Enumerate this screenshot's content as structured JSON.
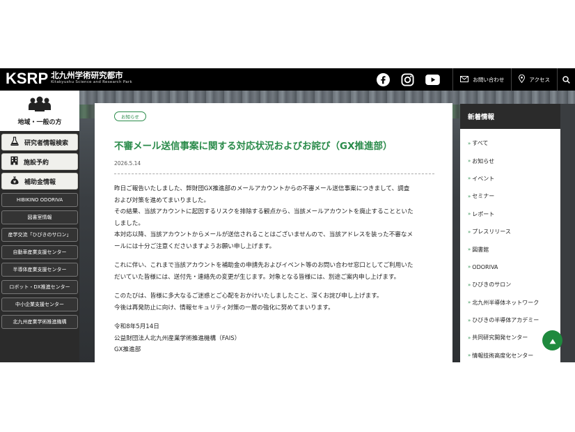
{
  "header": {
    "logo_mark": "KSRP",
    "logo_jp": "北九州学術研究都市",
    "logo_en": "Kitakyushu Science and Research Park",
    "contact_label": "お問い合わせ",
    "access_label": "アクセス"
  },
  "leftnav": {
    "region_label": "地域・一般の方",
    "big_buttons": [
      {
        "label": "研究者情報検索",
        "icon": "flask-icon"
      },
      {
        "label": "施設予約",
        "icon": "building-icon"
      },
      {
        "label": "補助金情報",
        "icon": "money-bag-icon"
      }
    ],
    "small_buttons": [
      "HIBIKINO ODORIVA",
      "図書室情報",
      "産学交流「ひびきのサロン」",
      "自動車産業支援センター",
      "半導体産業支援センター",
      "ロボット・DX推進センター",
      "中小企業支援センター",
      "北九州産業学術推進機構"
    ]
  },
  "article": {
    "tag": "お知らせ",
    "title": "不審メール送信事案に関する対応状況およびお詫び（GX推進部）",
    "date": "2026.5.14",
    "p1": [
      "昨日ご報告いたしました、弊財団GX推進部のメールアカウントからの不審メール送信事案につきまして、調査",
      "および対策を進めてまいりました。",
      "その結果、当該アカウントに起因するリスクを排除する観点から、当該メールアカウントを廃止することといた",
      "しました。",
      "本対応以降、当該アカウントからメールが送信されることはございませんので、当該アドレスを装った不審なメ",
      "ールには十分ご注意くださいますようお願い申し上げます。"
    ],
    "p2": [
      "これに伴い、これまで当該アカウントを補助金の申請先およびイベント等のお問い合わせ窓口としてご利用いた",
      "だいていた皆様には、送付先・連絡先の変更が生じます。対象となる皆様には、別途ご案内申し上げます。"
    ],
    "p3": [
      "このたびは、皆様に多大なるご迷惑とご心配をおかけいたしましたこと、深くお詫び申し上げます。",
      "今後は再発防止に向け、情報セキュリティ対策の一層の強化に努めてまいります。"
    ],
    "sign": [
      "令和8年5月14日",
      "公益財団法人北九州産業学術推進機構（FAIS）",
      "GX推進部"
    ]
  },
  "rightnav": {
    "heading": "新着情報",
    "items": [
      "すべて",
      "お知らせ",
      "イベント",
      "セミナー",
      "レポート",
      "プレスリリース",
      "図書館",
      "ODORIVA",
      "ひびきのサロン",
      "北九州半導体ネットワーク",
      "ひびきの半導体アカデミー",
      "共同研究開発センター",
      "情報技術高度化センター"
    ]
  },
  "colors": {
    "accent_green": "#2a8b4a",
    "header_bg": "#000000",
    "sidebar_bg": "#2b2b2b"
  }
}
